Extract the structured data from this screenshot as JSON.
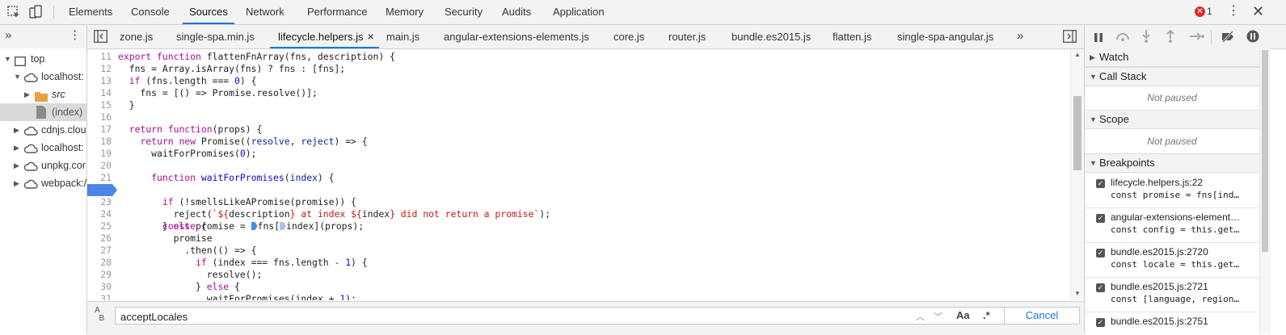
{
  "main_tabs": [
    "Elements",
    "Console",
    "Sources",
    "Network",
    "Performance",
    "Memory",
    "Security",
    "Audits",
    "Application"
  ],
  "active_main_tab": "Sources",
  "error_count": "1",
  "navigator_tree": [
    {
      "label": "top",
      "icon": "frame-icon"
    },
    {
      "label": "localhost:",
      "icon": "cloud-icon"
    },
    {
      "label": "src",
      "icon": "folder-icon"
    },
    {
      "label": "(index)",
      "icon": "file-icon"
    },
    {
      "label": "cdnjs.clou",
      "icon": "cloud-icon"
    },
    {
      "label": "localhost:",
      "icon": "cloud-icon"
    },
    {
      "label": "unpkg.cor",
      "icon": "cloud-icon"
    },
    {
      "label": "webpack:/",
      "icon": "cloud-icon"
    }
  ],
  "file_tabs": [
    "zone.js",
    "single-spa.min.js",
    "lifecycle.helpers.js",
    "main.js",
    "angular-extensions-elements.js",
    "core.js",
    "router.js",
    "bundle.es2015.js",
    "flatten.js",
    "single-spa-angular.js"
  ],
  "active_file_tab": "lifecycle.helpers.js",
  "close_glyph": "×",
  "code_lines": [
    {
      "n": "11"
    },
    {
      "n": "12"
    },
    {
      "n": "13"
    },
    {
      "n": "14"
    },
    {
      "n": "15"
    },
    {
      "n": "16"
    },
    {
      "n": "17"
    },
    {
      "n": "18"
    },
    {
      "n": "19"
    },
    {
      "n": "20"
    },
    {
      "n": "21"
    },
    {
      "n": "22"
    },
    {
      "n": "23"
    },
    {
      "n": "24"
    },
    {
      "n": "25"
    },
    {
      "n": "26"
    },
    {
      "n": "27"
    },
    {
      "n": "28"
    },
    {
      "n": "29"
    },
    {
      "n": "30"
    },
    {
      "n": "31"
    }
  ],
  "breakpoint_line": "22",
  "search": {
    "value": "acceptLocales",
    "cancel_label": "Cancel",
    "match_case_label": "Aa",
    "regex_label": ".*"
  },
  "right_sections": {
    "watch": "Watch",
    "call_stack": "Call Stack",
    "scope": "Scope",
    "breakpoints": "Breakpoints",
    "not_paused": "Not paused"
  },
  "breakpoints": [
    {
      "file": "lifecycle.helpers.js:22",
      "code": "const promise = fns[ind…"
    },
    {
      "file": "angular-extensions-element…",
      "code": "const config = this.get…"
    },
    {
      "file": "bundle.es2015.js:2720",
      "code": "const locale = this.get…"
    },
    {
      "file": "bundle.es2015.js:2721",
      "code": "const [language, region…"
    },
    {
      "file": "bundle.es2015.js:2751",
      "code": ""
    }
  ],
  "colors": {
    "accent": "#1a73e8",
    "breakpoint": "#4a86e8",
    "error": "#d93025"
  }
}
